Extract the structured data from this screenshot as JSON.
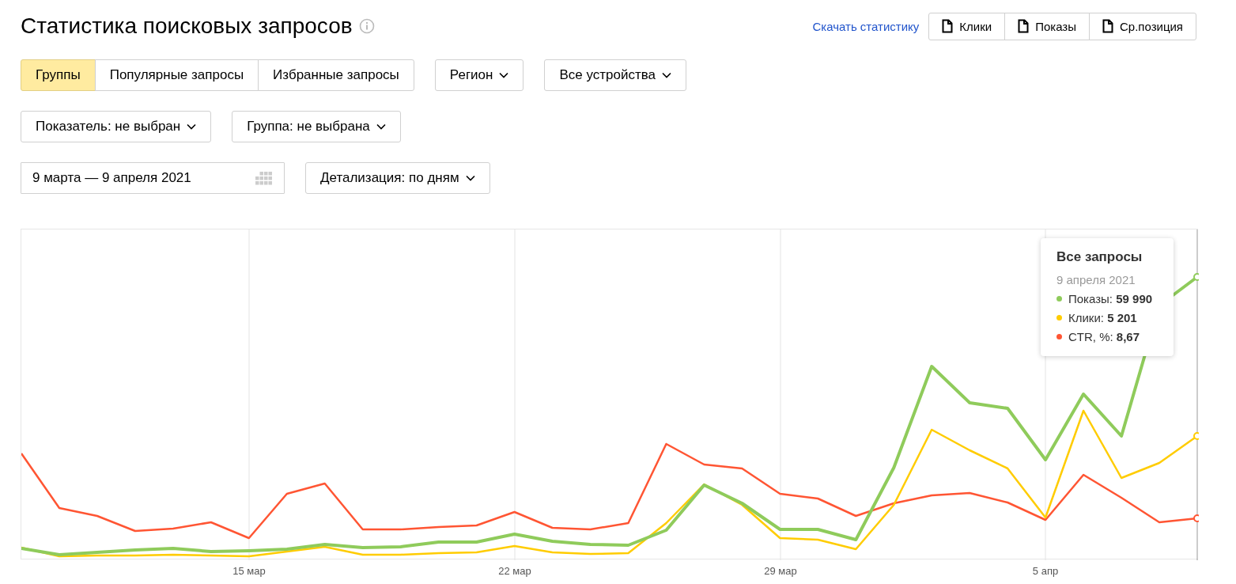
{
  "title": "Статистика поисковых запросов",
  "download_link": "Скачать статистику",
  "export_buttons": [
    "Клики",
    "Показы",
    "Ср.позиция"
  ],
  "tabs": [
    {
      "label": "Группы",
      "selected": true
    },
    {
      "label": "Популярные запросы",
      "selected": false
    },
    {
      "label": "Избранные запросы",
      "selected": false
    }
  ],
  "filters_row1": [
    "Регион",
    "Все устройства"
  ],
  "filters_row2": [
    "Показатель: не выбран",
    "Группа: не выбрана"
  ],
  "date_range": {
    "value": "9 марта — 9 апреля 2021"
  },
  "detail_dropdown": "Детализация: по дням",
  "chart": {
    "x_labels": [
      "15 мар",
      "22 мар",
      "29 мар",
      "5 апр"
    ],
    "tooltip": {
      "title": "Все запросы",
      "date": "9 апреля 2021",
      "items": [
        {
          "text": "Показы: **59 990**",
          "color": "#8fcb5b"
        },
        {
          "text": "Клики: **5 201**",
          "color": "#ffcc00"
        },
        {
          "text": "CTR, %: **8,67**",
          "color": "#ff5533"
        }
      ]
    }
  }
}
